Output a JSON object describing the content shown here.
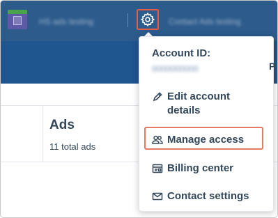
{
  "topbar": {
    "account_name_blurred": "HS ads testing",
    "account_switcher_blurred": "Contact Ads testing",
    "bg_color": "#2c5b8c",
    "gear_icon": "gear-icon"
  },
  "content": {
    "ads_title": "Ads",
    "ads_count": "11 total ads"
  },
  "dropdown": {
    "account_id_label": "Account ID:",
    "account_id_value": "0000000000",
    "items": [
      {
        "label": "Edit account details",
        "icon": "pencil-icon"
      },
      {
        "label": "Manage access",
        "icon": "users-icon",
        "highlighted": true
      },
      {
        "label": "Billing center",
        "icon": "billing-icon"
      },
      {
        "label": "Contact settings",
        "icon": "envelope-icon"
      }
    ],
    "highlight_color": "#e77962"
  }
}
